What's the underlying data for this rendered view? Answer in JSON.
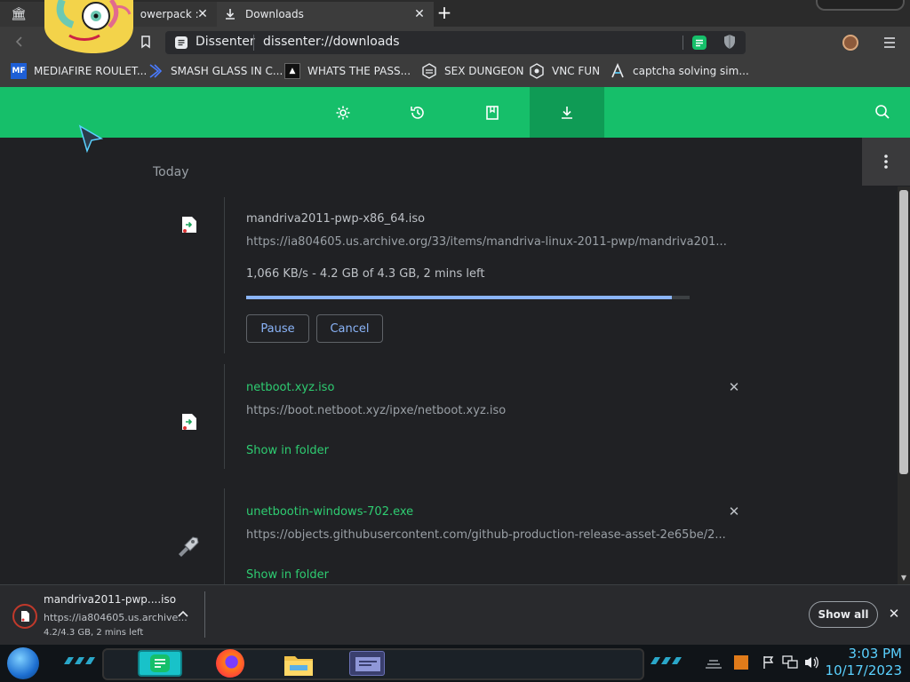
{
  "tabs": [
    {
      "label": "owerpack :",
      "active": false
    },
    {
      "label": "Downloads",
      "active": true
    }
  ],
  "address": {
    "site_name": "Dissenter",
    "url": "dissenter://downloads"
  },
  "bookmarks": [
    {
      "label": "MEDIAFIRE ROULET...",
      "icon": "mediafire-icon"
    },
    {
      "label": "SMASH GLASS IN C...",
      "icon": "smash-icon"
    },
    {
      "label": "WHATS THE PASS...",
      "icon": "pass-icon"
    },
    {
      "label": "SEX DUNGEON",
      "icon": "dungeon-icon"
    },
    {
      "label": "VNC FUN",
      "icon": "vnc-icon"
    },
    {
      "label": "captcha solving sim...",
      "icon": "captcha-icon"
    }
  ],
  "toolbar": {
    "active_tab": "downloads"
  },
  "section_label": "Today",
  "downloads": [
    {
      "filename": "mandriva2011-pwp-x86_64.iso",
      "url": "https://ia804605.us.archive.org/33/items/mandriva-linux-2011-pwp/mandriva201...",
      "status": "1,066 KB/s - 4.2 GB of 4.3 GB, 2 mins left",
      "progress": 0.96,
      "pause_label": "Pause",
      "cancel_label": "Cancel"
    },
    {
      "filename": "netboot.xyz.iso",
      "url": "https://boot.netboot.xyz/ipxe/netboot.xyz.iso",
      "action_label": "Show in folder"
    },
    {
      "filename": "unetbootin-windows-702.exe",
      "url": "https://objects.githubusercontent.com/github-production-release-asset-2e65be/2...",
      "action_label": "Show in folder"
    }
  ],
  "shelf": {
    "name": "mandriva2011-pwp....iso",
    "url": "https://ia804605.us.archive...",
    "status": "4.2/4.3 GB, 2 mins left",
    "show_all_label": "Show all"
  },
  "taskbar": {
    "time": "3:03 PM",
    "date": "10/17/2023"
  },
  "colors": {
    "accent_green": "#16bf6a",
    "active_green": "#0f9b55",
    "progress_blue": "#8ab4f8",
    "link_green": "#2ecc71"
  }
}
